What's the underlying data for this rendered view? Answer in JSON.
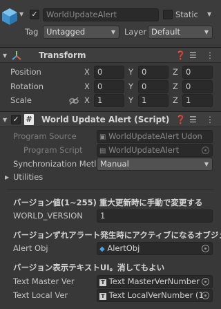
{
  "gameobject": {
    "active_checked": "✓",
    "name": "WorldUpdateAlert",
    "static_label": "Static",
    "tag_label": "Tag",
    "tag_value": "Untagged",
    "layer_label": "Layer",
    "layer_value": "Default"
  },
  "transform": {
    "title": "Transform",
    "position_label": "Position",
    "rotation_label": "Rotation",
    "scale_label": "Scale",
    "axes": [
      "X",
      "Y",
      "Z"
    ],
    "position": [
      "0",
      "0",
      "0"
    ],
    "rotation": [
      "0",
      "0",
      "0"
    ],
    "scale": [
      "1",
      "1",
      "1"
    ]
  },
  "script": {
    "title": "World Update Alert (Script)",
    "program_source_label": "Program Source",
    "program_source_value": "WorldUpdateAlert Udon",
    "program_script_label": "Program Script",
    "program_script_value": "WorldUpdateAlert",
    "sync_label": "Synchronization Metl",
    "sync_value": "Manual",
    "utilities_label": "Utilities",
    "version_header": "バージョン値(1~255) 重大更新時に手動で変更する",
    "world_version_label": "WORLD_VERSION",
    "world_version_value": "1",
    "alert_header": "バージョンずれアラート発生時にアクティブになるオブジェクト",
    "alert_obj_label": "Alert Obj",
    "alert_obj_value": "AlertObj",
    "text_header": "バージョン表示テキストUI。消してもよい",
    "text_master_label": "Text Master Ver",
    "text_master_value": "Text MasterVerNumber",
    "text_local_label": "Text Local Ver",
    "text_local_value": "Text LocalVerNumber (1"
  },
  "colors": {
    "background": "#383838",
    "field": "#2a2a2a",
    "header": "#3e3e3e",
    "cube_icon": "#4aa3df",
    "script_icon": "#e8e8e8"
  }
}
